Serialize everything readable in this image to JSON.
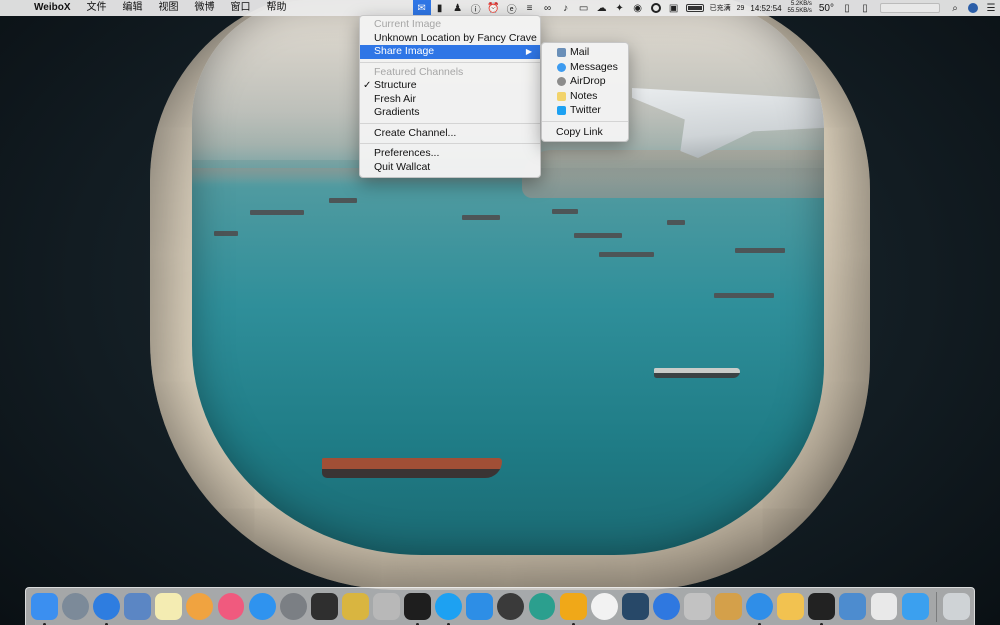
{
  "menubar": {
    "apple_glyph": "",
    "app_name": "WeiboX",
    "menus": [
      "文件",
      "编辑",
      "视图",
      "微博",
      "窗口",
      "帮助"
    ],
    "status": {
      "charging_label": "已充满",
      "date_badge": "29",
      "clock": "14:52:54",
      "net_up": "5.2KB/s",
      "net_down": "55.5KB/s",
      "temperature": "50°"
    }
  },
  "wallcat_menu": {
    "current_image_header": "Current Image",
    "image_location": "Unknown Location by Fancy Crave",
    "share_image": "Share Image",
    "featured_header": "Featured Channels",
    "channels": [
      {
        "label": "Structure",
        "checked": true
      },
      {
        "label": "Fresh Air",
        "checked": false
      },
      {
        "label": "Gradients",
        "checked": false
      }
    ],
    "create_channel": "Create Channel...",
    "preferences": "Preferences...",
    "quit": "Quit Wallcat"
  },
  "share_menu": {
    "items": [
      {
        "label": "Mail",
        "icon": "mail-icon",
        "color": "#6a8fb8"
      },
      {
        "label": "Messages",
        "icon": "messages-icon",
        "color": "#3d9bf0"
      },
      {
        "label": "AirDrop",
        "icon": "airdrop-icon",
        "color": "#8c8c8c"
      },
      {
        "label": "Notes",
        "icon": "notes-icon",
        "color": "#f2d36b"
      },
      {
        "label": "Twitter",
        "icon": "twitter-icon",
        "color": "#1da1f2"
      }
    ],
    "copy_link": "Copy Link"
  },
  "dock": {
    "apps": [
      {
        "name": "finder",
        "color": "#3b8ff0",
        "running": true
      },
      {
        "name": "launchpad",
        "color": "#7c8a99",
        "running": false
      },
      {
        "name": "safari",
        "color": "#2e7de0",
        "running": true
      },
      {
        "name": "preview",
        "color": "#5b86c4",
        "running": false
      },
      {
        "name": "stickies",
        "color": "#f4ecb2",
        "running": false
      },
      {
        "name": "photos",
        "color": "#f0a340",
        "running": false
      },
      {
        "name": "itunes",
        "color": "#f05a7e",
        "running": false
      },
      {
        "name": "app-store",
        "color": "#2f93ef",
        "running": false
      },
      {
        "name": "system-preferences",
        "color": "#7b7f84",
        "running": false
      },
      {
        "name": "reminders",
        "color": "#2f2f2f",
        "running": false
      },
      {
        "name": "installer",
        "color": "#d9b540",
        "running": false
      },
      {
        "name": "keychain",
        "color": "#b8b8b8",
        "running": false
      },
      {
        "name": "terminal",
        "color": "#1e1e1e",
        "running": true
      },
      {
        "name": "twitter",
        "color": "#1da1f2",
        "running": true
      },
      {
        "name": "weibo-cloud",
        "color": "#2d8ee6",
        "running": false
      },
      {
        "name": "media-button",
        "color": "#3a3a3a",
        "running": false
      },
      {
        "name": "cube-app",
        "color": "#2b9f8e",
        "running": false
      },
      {
        "name": "duck-app",
        "color": "#f0a818",
        "running": true
      },
      {
        "name": "sync-app",
        "color": "#f2f2f2",
        "running": false
      },
      {
        "name": "toolbox-app",
        "color": "#274868",
        "running": false
      },
      {
        "name": "navigation-app",
        "color": "#2f78e0",
        "running": false
      },
      {
        "name": "package-app",
        "color": "#c2c2c2",
        "running": false
      },
      {
        "name": "drawing-app",
        "color": "#d4a04a",
        "running": false
      },
      {
        "name": "weibox-app",
        "color": "#2f8ee8",
        "running": true
      },
      {
        "name": "notes-app",
        "color": "#f2c250",
        "running": false
      },
      {
        "name": "qq-app",
        "color": "#222222",
        "running": true
      },
      {
        "name": "photo-app",
        "color": "#4d8ccf",
        "running": false
      },
      {
        "name": "paper-app",
        "color": "#e9e9e9",
        "running": false
      },
      {
        "name": "bookmark-app",
        "color": "#3ba0ef",
        "running": false
      }
    ],
    "trash": {
      "name": "trash",
      "color": "#cfd3d6"
    }
  }
}
